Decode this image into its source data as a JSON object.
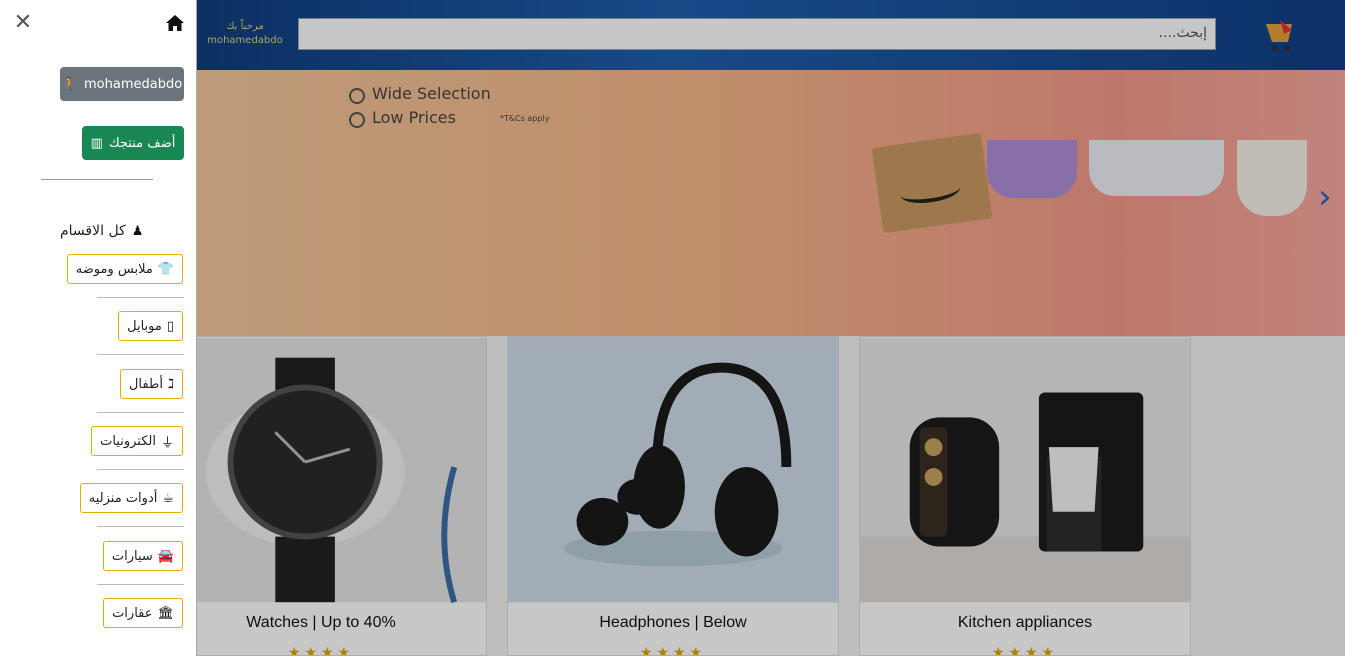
{
  "header": {
    "search_placeholder": "إبحث....",
    "greeting": "مرحباً بك",
    "username": "mohamedabdo"
  },
  "banner": {
    "line1": "Wide Selection",
    "line2": "Low Prices",
    "note": "*T&Cs apply"
  },
  "cards": [
    {
      "caption": "Watches | Up to 40%",
      "stars": "★★★★"
    },
    {
      "caption": "Headphones | Below",
      "stars": "★★★★"
    },
    {
      "caption": "Kitchen appliances",
      "stars": "★★★★"
    }
  ],
  "sidebar": {
    "user_label": "mohamedabdo",
    "add_product_label": "أضف منتجك",
    "categories_title": "كل الاقسام",
    "items": [
      {
        "label": "ملابس وموضه",
        "icon": "shirt-icon"
      },
      {
        "label": "موبايل",
        "icon": "mobile-icon"
      },
      {
        "label": "أطفال",
        "icon": "child-icon"
      },
      {
        "label": "الكترونيات",
        "icon": "plug-icon"
      },
      {
        "label": "أدوات منزليه",
        "icon": "mug-icon"
      },
      {
        "label": "سيارات",
        "icon": "car-icon"
      },
      {
        "label": "عقارات",
        "icon": "building-icon"
      }
    ]
  },
  "colors": {
    "user_button": "#6c757d",
    "add_button": "#198754",
    "category_border": "#e0b000",
    "topbar": "#123f86"
  }
}
